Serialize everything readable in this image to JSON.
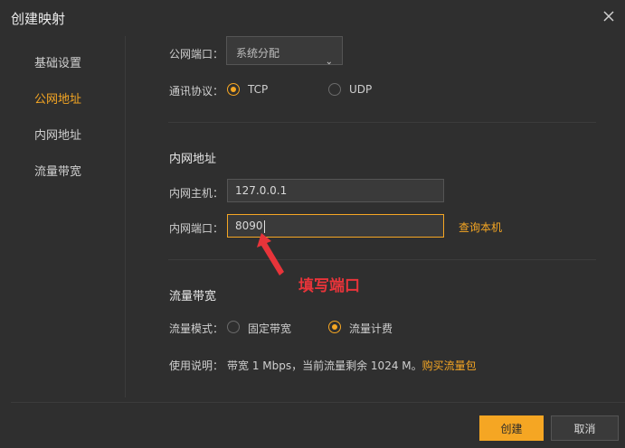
{
  "dialog": {
    "title": "创建映射"
  },
  "sidebar": {
    "items": [
      {
        "label": "基础设置",
        "active": false
      },
      {
        "label": "公网地址",
        "active": true
      },
      {
        "label": "内网地址",
        "active": false
      },
      {
        "label": "流量带宽",
        "active": false
      }
    ]
  },
  "public": {
    "port_label": "公网端口：",
    "port_value": "系统分配",
    "protocol_label": "通讯协议：",
    "protocol_options": [
      "TCP",
      "UDP"
    ],
    "protocol_selected": "TCP"
  },
  "internal": {
    "section_title": "内网地址",
    "host_label": "内网主机：",
    "host_value": "127.0.0.1",
    "port_label": "内网端口：",
    "port_value": "8090",
    "query_link": "查询本机"
  },
  "bandwidth": {
    "section_title": "流量带宽",
    "mode_label": "流量模式：",
    "mode_options": [
      "固定带宽",
      "流量计费"
    ],
    "mode_selected": "流量计费",
    "usage_label": "使用说明：",
    "usage_text": "带宽 1 Mbps，当前流量剩余 1024 M。",
    "buy_link": "购买流量包"
  },
  "annotation": {
    "text": "填写端口"
  },
  "footer": {
    "create_label": "创建",
    "cancel_label": "取消"
  },
  "colors": {
    "accent": "#f5a623",
    "annotation": "#e8343a",
    "background": "#2f2f2f"
  }
}
